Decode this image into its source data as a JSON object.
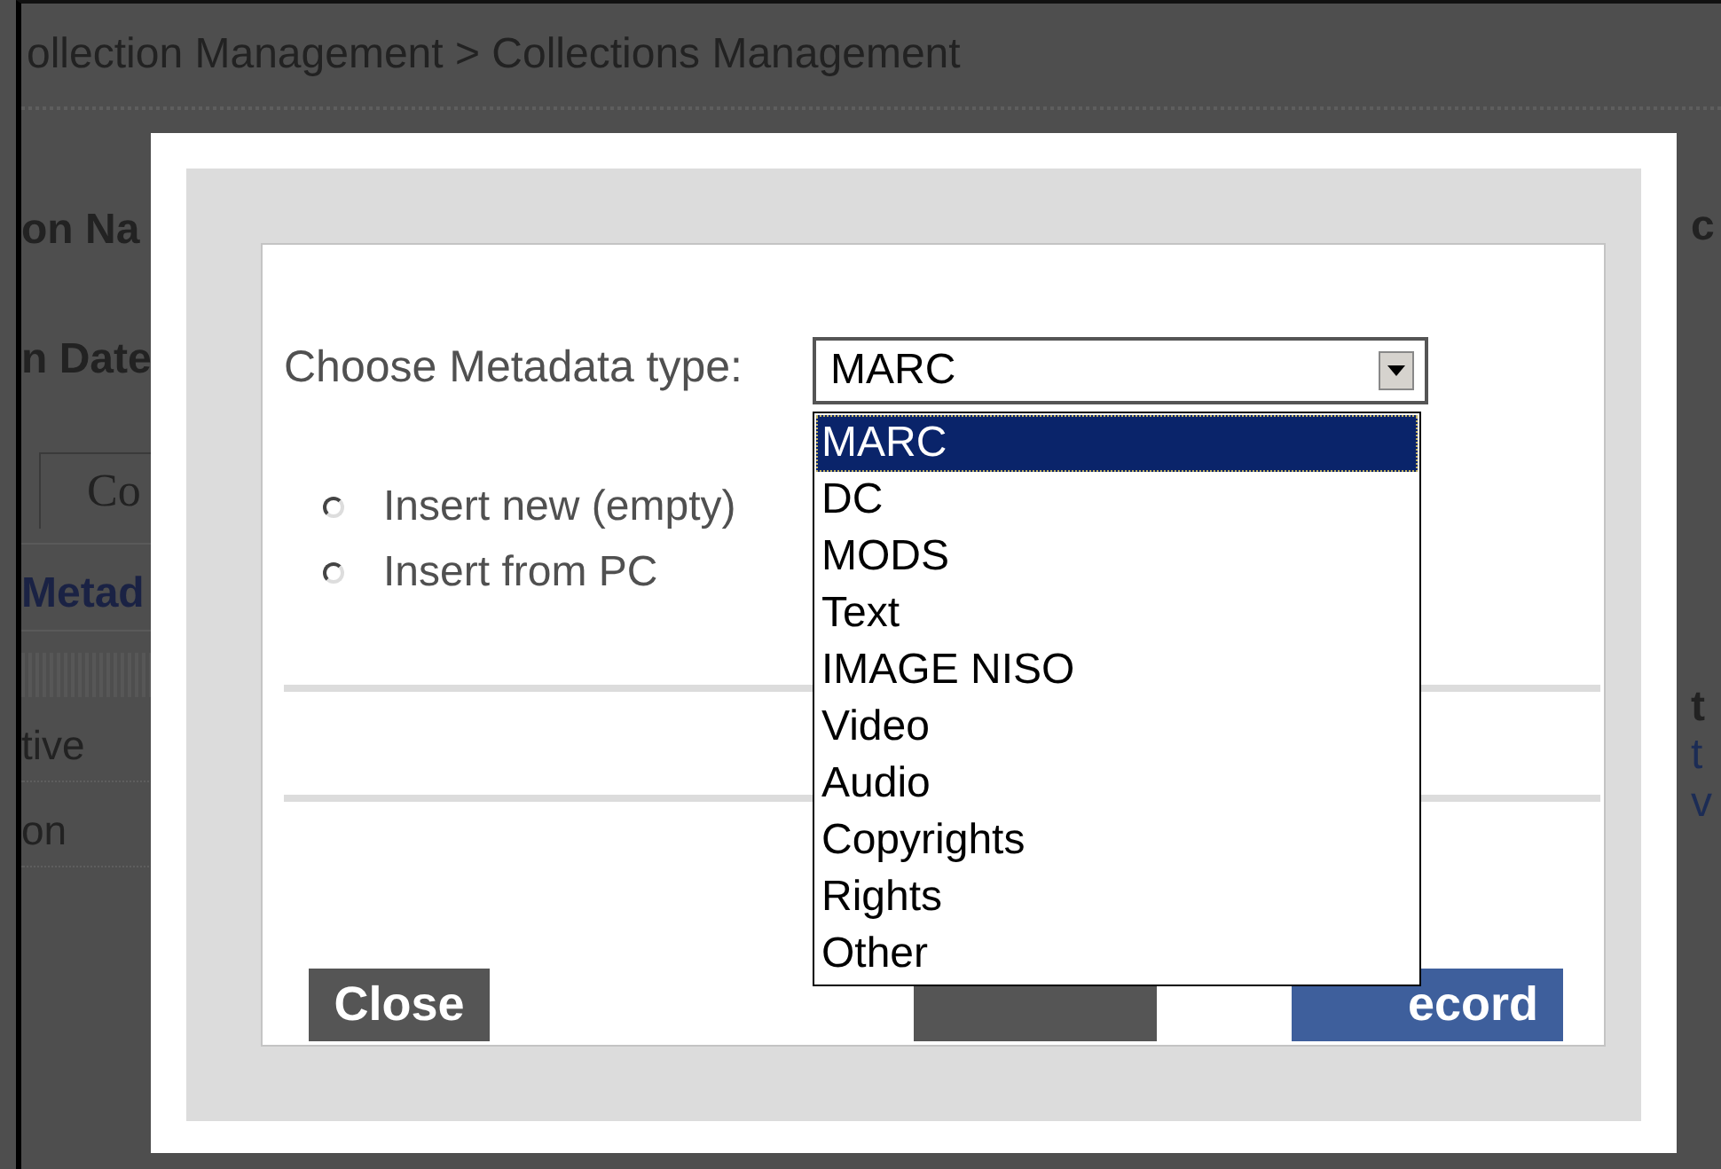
{
  "breadcrumb": "ollection Management > Collections Management",
  "background": {
    "left_items": [
      {
        "kind": "label",
        "text": "on Na"
      },
      {
        "kind": "label",
        "text": "n Date"
      },
      {
        "kind": "tab",
        "text": "Co"
      },
      {
        "kind": "heading",
        "text": "Metad"
      },
      {
        "kind": "row",
        "text": "tive"
      },
      {
        "kind": "row",
        "text": "on"
      }
    ],
    "right_items": [
      {
        "kind": "label",
        "text": "c"
      },
      {
        "kind": "label",
        "text": "t"
      },
      {
        "kind": "link",
        "text": "t"
      },
      {
        "kind": "link",
        "text": "v"
      }
    ]
  },
  "modal": {
    "metadata_label": "Choose Metadata type:",
    "select": {
      "value": "MARC",
      "expanded": true,
      "options": [
        {
          "label": "MARC",
          "selected": true
        },
        {
          "label": "DC",
          "selected": false
        },
        {
          "label": "MODS",
          "selected": false
        },
        {
          "label": "Text",
          "selected": false
        },
        {
          "label": "IMAGE NISO",
          "selected": false
        },
        {
          "label": "Video",
          "selected": false
        },
        {
          "label": "Audio",
          "selected": false
        },
        {
          "label": "Copyrights",
          "selected": false
        },
        {
          "label": "Rights",
          "selected": false
        },
        {
          "label": "Other",
          "selected": false
        }
      ]
    },
    "radios": [
      {
        "label": "Insert new (empty)",
        "selected": false
      },
      {
        "label": "Insert from PC",
        "selected": false
      }
    ],
    "buttons": [
      {
        "kind": "close",
        "label": "Close"
      },
      {
        "kind": "secondary"
      },
      {
        "kind": "primary",
        "label": "ecord"
      }
    ]
  }
}
